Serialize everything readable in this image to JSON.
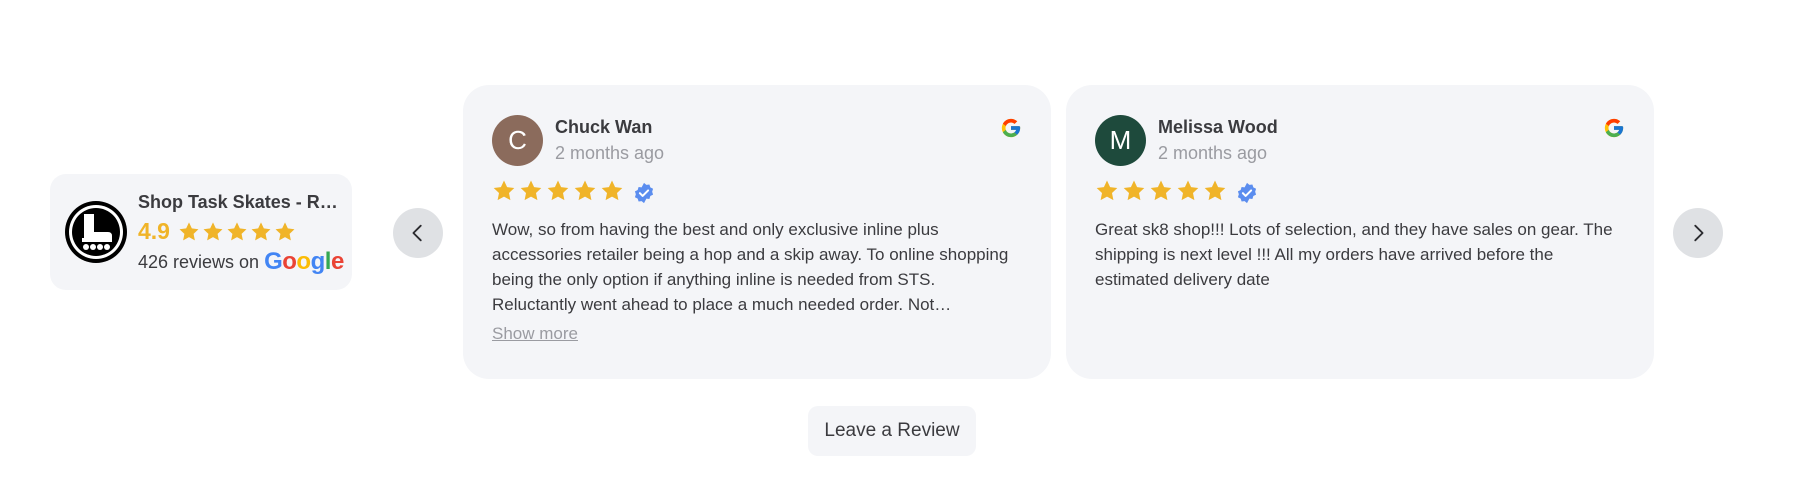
{
  "colors": {
    "accent_star": "#f0b429",
    "card_bg": "#f4f5f8",
    "verified_blue": "#5b8def",
    "avatar_chuck": "#8b6b5c",
    "avatar_melissa": "#1e4a3c"
  },
  "summary": {
    "business_name": "Shop Task Skates - Rol...",
    "rating": "4.9",
    "stars": 5,
    "reviews_text": "426 reviews on",
    "google_letters": [
      "G",
      "o",
      "o",
      "g",
      "l",
      "e"
    ]
  },
  "navigation": {
    "prev_icon": "chevron-left-icon",
    "next_icon": "chevron-right-icon"
  },
  "reviews": [
    {
      "avatar_letter": "C",
      "name": "Chuck Wan",
      "date": "2 months ago",
      "rating": 5,
      "verified": true,
      "text": "Wow, so from having the best and only exclusive inline plus accessories retailer being a hop and a skip away. To online shopping being the only option if anything inline is needed from STS. Reluctantly went ahead to place a much needed order. Not…",
      "show_more_label": "Show more",
      "source_icon": "google-icon"
    },
    {
      "avatar_letter": "M",
      "name": "Melissa Wood",
      "date": "2 months ago",
      "rating": 5,
      "verified": true,
      "text": "Great sk8 shop!!! Lots of selection, and they have sales on gear. The shipping is next level !!! All my orders have arrived before the estimated delivery date",
      "source_icon": "google-icon"
    }
  ],
  "leave_review_label": "Leave a Review"
}
